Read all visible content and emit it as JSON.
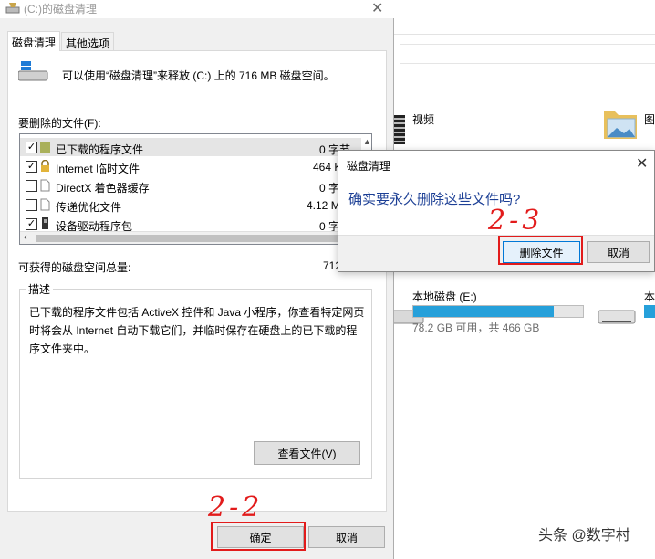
{
  "explorer": {
    "items": [
      {
        "label": "视频"
      },
      {
        "label": "图"
      }
    ],
    "drives": [
      {
        "label": "本地磁盘 (E:)",
        "free": "78.2 GB 可用，共 466 GB",
        "used_fraction": 0.83
      },
      {
        "label": "本"
      }
    ]
  },
  "cleanup": {
    "title": "(C:)的磁盘清理",
    "tabs": [
      "磁盘清理",
      "其他选项"
    ],
    "summary": "可以使用“磁盘清理”来释放  (C:) 上的 716 MB 磁盘空间。",
    "files_label": "要删除的文件(F):",
    "files": [
      {
        "name": "已下载的程序文件",
        "size": "0 字节",
        "checked": true,
        "icon": "folder-icon"
      },
      {
        "name": "Internet 临时文件",
        "size": "464 K",
        "checked": true,
        "icon": "lock-icon"
      },
      {
        "name": "DirectX 着色器缓存",
        "size": "0 字",
        "checked": false,
        "icon": "file-icon"
      },
      {
        "name": "传递优化文件",
        "size": "4.12 M",
        "checked": false,
        "icon": "file-icon"
      },
      {
        "name": "设备驱动程序包",
        "size": "0 字",
        "checked": true,
        "icon": "device-icon"
      }
    ],
    "total_label": "可获得的磁盘空间总量:",
    "total_value": "712",
    "description_legend": "描述",
    "description": "已下载的程序文件包括 ActiveX 控件和 Java 小程序，你查看特定网页时将会从 Internet 自动下载它们，并临时保存在硬盘上的已下载的程序文件夹中。",
    "view_files_button": "查看文件(V)",
    "ok_button": "确定",
    "cancel_button": "取消"
  },
  "confirm": {
    "title": "磁盘清理",
    "message": "确实要永久删除这些文件吗?",
    "delete_button": "删除文件",
    "cancel_button": "取消"
  },
  "annotations": {
    "step_ok": "2-2",
    "step_delete": "2-3"
  },
  "watermark": "头条 @数字村",
  "colors": {
    "annotation": "#e21b1b",
    "accent": "#26a0da",
    "dialog_text": "#1c3f95"
  }
}
